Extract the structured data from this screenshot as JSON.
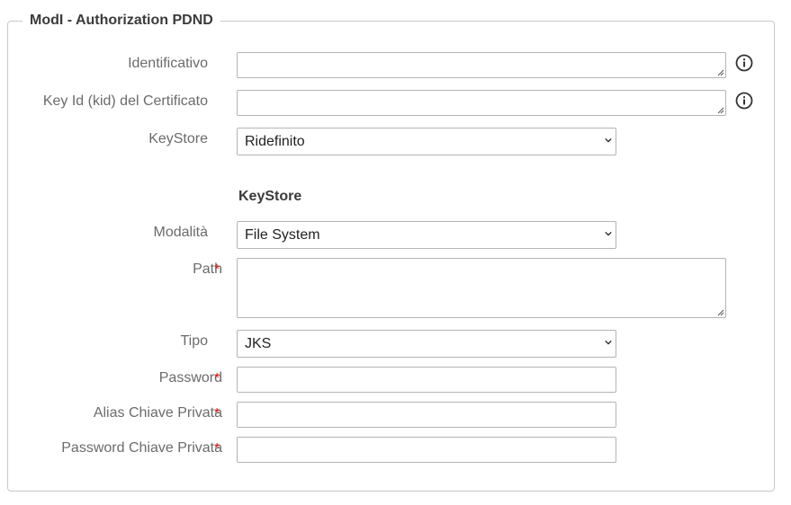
{
  "legend": "ModI - Authorization PDND",
  "fields": {
    "identificativo": {
      "label": "Identificativo",
      "value": ""
    },
    "kid": {
      "label": "Key Id (kid) del Certificato",
      "value": ""
    },
    "keystore_mode": {
      "label": "KeyStore",
      "selected": "Ridefinito"
    }
  },
  "keystore_section": {
    "title": "KeyStore",
    "modalita": {
      "label": "Modalità",
      "selected": "File System"
    },
    "path": {
      "label": "Path",
      "value": ""
    },
    "tipo": {
      "label": "Tipo",
      "selected": "JKS"
    },
    "password": {
      "label": "Password",
      "value": ""
    },
    "alias": {
      "label": "Alias Chiave Privata",
      "value": ""
    },
    "password_chiave": {
      "label": "Password Chiave Privata",
      "value": ""
    }
  },
  "required_marker": "*",
  "icons": {
    "info": "info-circle-icon",
    "dropdown": "chevron-down-icon",
    "resize": "resize-grip-icon"
  },
  "colors": {
    "required": "#cc1f1f",
    "label": "#6b6b6b",
    "border": "#b4b4b4"
  }
}
